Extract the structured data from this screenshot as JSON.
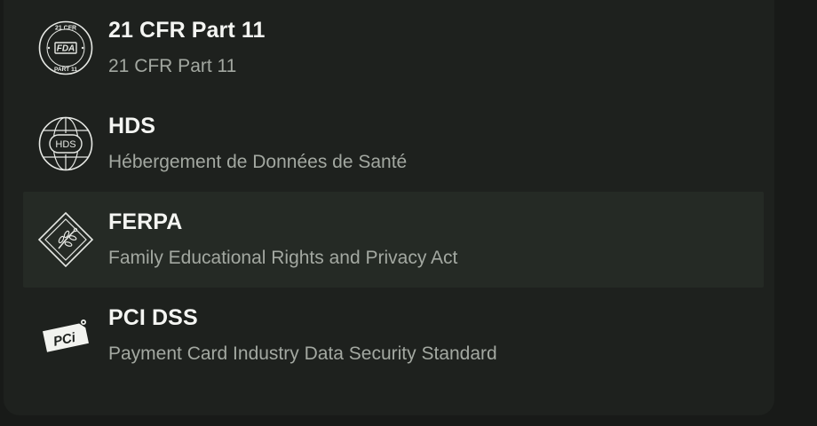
{
  "compliance": {
    "items": [
      {
        "icon": "fda-cfr-part-11-badge-icon",
        "title": "21 CFR Part 11",
        "subtitle": "21 CFR Part 11",
        "badge_top_text": "21 CFR",
        "badge_center_text": "FDA",
        "badge_bottom_text": "PART 11"
      },
      {
        "icon": "hds-globe-badge-icon",
        "title": "HDS",
        "subtitle": "Hébergement de Données de Santé",
        "badge_center_text": "HDS"
      },
      {
        "icon": "ferpa-diamond-badge-icon",
        "title": "FERPA",
        "subtitle": "Family Educational Rights and Privacy Act",
        "highlighted": true
      },
      {
        "icon": "pci-card-badge-icon",
        "title": "PCI DSS",
        "subtitle": "Payment Card Industry Data Security Standard",
        "badge_center_text": "PCi"
      }
    ]
  },
  "colors": {
    "background": "#181a18",
    "panel": "#1e211e",
    "highlight_row": "#252a25",
    "title": "#f4f5f2",
    "subtitle": "#a3a8a1",
    "icon": "#e6e8e4"
  }
}
